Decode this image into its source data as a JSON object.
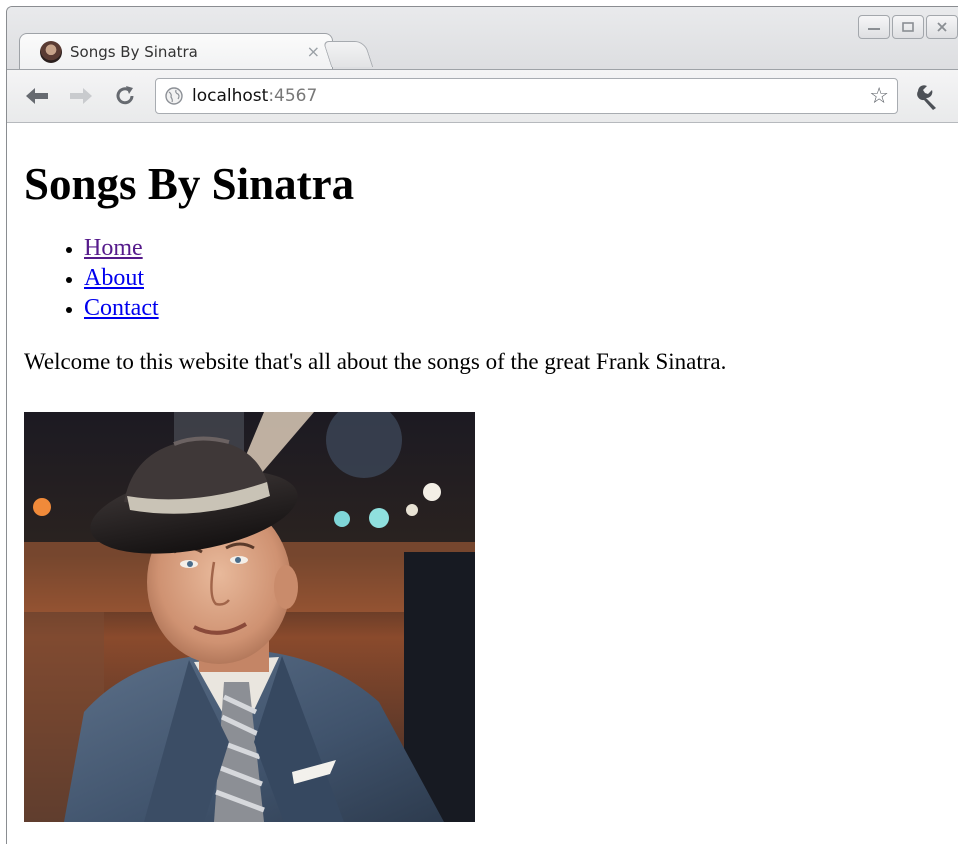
{
  "browser": {
    "tab": {
      "title": "Songs By Sinatra",
      "close_glyph": "×"
    },
    "url": {
      "host": "localhost",
      "port": ":4567"
    },
    "icons": [
      "back-icon",
      "forward-icon",
      "reload-icon",
      "globe-icon",
      "star-icon",
      "wrench-icon",
      "minimize-icon",
      "maximize-icon",
      "close-icon"
    ]
  },
  "page": {
    "heading": "Songs By Sinatra",
    "nav": [
      {
        "label": "Home",
        "visited": true
      },
      {
        "label": "About",
        "visited": false
      },
      {
        "label": "Contact",
        "visited": false
      }
    ],
    "welcome": "Welcome to this website that's all about the songs of the great Frank Sinatra."
  },
  "colors": {
    "link": "#0000ee",
    "visited_link": "#551a8b"
  }
}
